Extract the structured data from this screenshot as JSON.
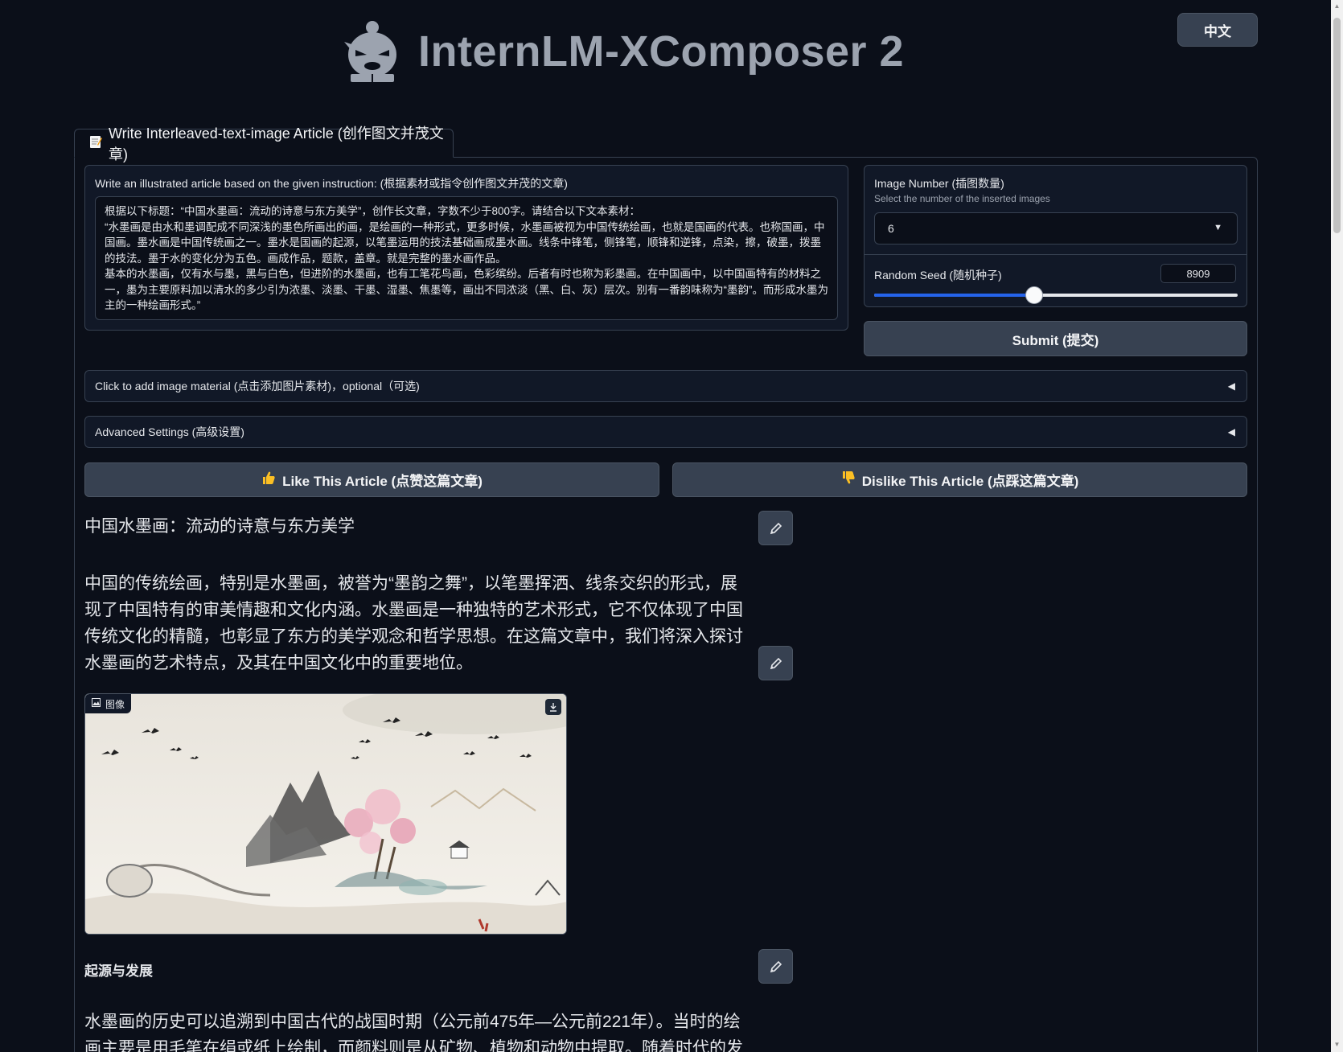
{
  "header": {
    "title": "InternLM-XComposer 2",
    "lang_button": "中文"
  },
  "tab": {
    "icon": "memo-icon",
    "label": "Write Interleaved-text-image Article (创作图文并茂文章)"
  },
  "instruction": {
    "label": "Write an illustrated article based on the given instruction: (根据素材或指令创作图文并茂的文章)",
    "value": "根据以下标题：“中国水墨画：流动的诗意与东方美学”，创作长文章，字数不少于800字。请结合以下文本素材：\n“水墨画是由水和墨调配成不同深浅的墨色所画出的画，是绘画的一种形式，更多时候，水墨画被视为中国传统绘画，也就是国画的代表。也称国画，中国画。墨水画是中国传统画之一。墨水是国画的起源，以笔墨运用的技法基础画成墨水画。线条中锋笔，侧锋笔，顺锋和逆锋，点染，擦，破墨，拨墨的技法。墨于水的变化分为五色。画成作品，题款，盖章。就是完整的墨水画作品。\n基本的水墨画，仅有水与墨，黑与白色，但进阶的水墨画，也有工笔花鸟画，色彩缤纷。后者有时也称为彩墨画。在中国画中，以中国画特有的材料之一，墨为主要原料加以清水的多少引为浓墨、淡墨、干墨、湿墨、焦墨等，画出不同浓淡（黑、白、灰）层次。别有一番韵味称为“墨韵”。而形成水墨为主的一种绘画形式。”"
  },
  "image_number": {
    "label": "Image Number (插图数量)",
    "info": "Select the number of the inserted images",
    "value": "6"
  },
  "random_seed": {
    "label": "Random Seed (随机种子)",
    "value": "8909",
    "fraction": 0.44
  },
  "submit_label": "Submit (提交)",
  "accordions": {
    "image_material": "Click to add image material (点击添加图片素材)，optional（可选)",
    "advanced": "Advanced Settings (高级设置)"
  },
  "feedback": {
    "like": "Like This Article (点赞这篇文章)",
    "dislike": "Dislike This Article (点踩这篇文章)"
  },
  "article": {
    "title": "中国水墨画：流动的诗意与东方美学",
    "intro": "中国的传统绘画，特别是水墨画，被誉为“墨韵之舞”，以笔墨挥洒、线条交织的形式，展现了中国特有的审美情趣和文化内涵。水墨画是一种独特的艺术形式，它不仅体现了中国传统文化的精髓，也彰显了东方的美学观念和哲学思想。在这篇文章中，我们将深入探讨水墨画的艺术特点，及其在中国文化中的重要地位。",
    "image_label": "图像",
    "section_title": "起源与发展",
    "section_text": "水墨画的历史可以追溯到中国古代的战国时期（公元前475年—公元前221年）。当时的绘画主要是用毛笔在绢或纸上绘制，而颜料则是从矿物、植物和动物中提取。随着时代的发展，绘画"
  },
  "colors": {
    "background": "#0b0f19",
    "block": "#111827",
    "border": "#374151",
    "button": "#374151",
    "slider_fill": "#2563eb"
  }
}
